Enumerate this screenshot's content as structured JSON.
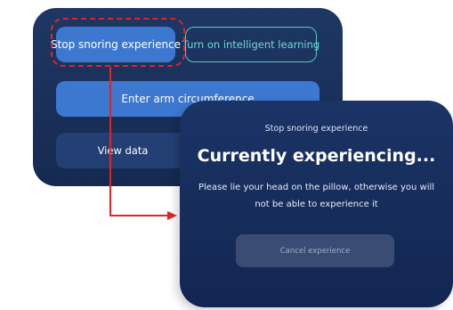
{
  "main_screen": {
    "stop_snoring_label": "Stop snoring experience",
    "intelligent_learning_label": "Turn on intelligent learning",
    "arm_circumference_label": "Enter arm circumference",
    "view_data_label": "View data"
  },
  "experience_screen": {
    "title": "Stop snoring experience",
    "heading": "Currently experiencing...",
    "message": "Please lie your head on the pillow, otherwise you will not be able to experience it",
    "cancel_label": "Cancel experience"
  },
  "colors": {
    "screen_background": "#1b3466",
    "primary_button": "#3d78d0",
    "outline_accent": "#59c8c0",
    "highlight_red": "#e02424"
  }
}
